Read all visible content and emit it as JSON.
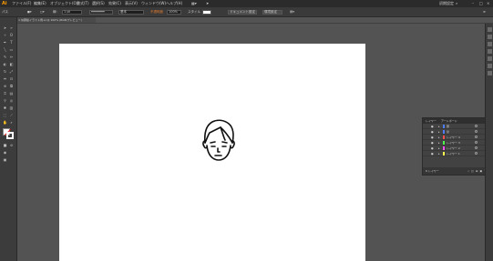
{
  "app": {
    "logo": "Ai"
  },
  "menubar": {
    "items": [
      "ファイル(F)",
      "編集(E)",
      "オブジェクト(O)",
      "書式(T)",
      "選択(S)",
      "効果(C)",
      "表示(V)",
      "ウィンドウ(W)",
      "ヘルプ(H)"
    ],
    "workspace": "初期設定"
  },
  "controlbar": {
    "selection": "パス",
    "stroke_label": "線:",
    "stroke_value": "1 pt",
    "brush": "基本",
    "opacity_label": "不透明度",
    "opacity_value": "100%",
    "style_label": "スタイル",
    "doc_setup": "ドキュメント設定",
    "prefs": "環境設定"
  },
  "document_tab": {
    "title": "似顔絵イラスト例.ai @ 100% (RGB/プレビュー)"
  },
  "layers_panel": {
    "tabs": [
      "レイヤー",
      "アートボード"
    ],
    "rows": [
      {
        "name": "顔",
        "color": "#4f7cff"
      },
      {
        "name": "髪",
        "color": "#4f7cff"
      },
      {
        "name": "レイヤー 4",
        "color": "#ff4f4f"
      },
      {
        "name": "レイヤー 3",
        "color": "#4fff4f"
      },
      {
        "name": "レイヤー 2",
        "color": "#ff4fff"
      },
      {
        "name": "レイヤー 1",
        "color": "#ffff4f"
      }
    ],
    "footer_label": "6 レイヤー"
  },
  "colors": {
    "accent": "#ff9a00",
    "canvas_bg": "#535353",
    "artboard": "#ffffff"
  }
}
